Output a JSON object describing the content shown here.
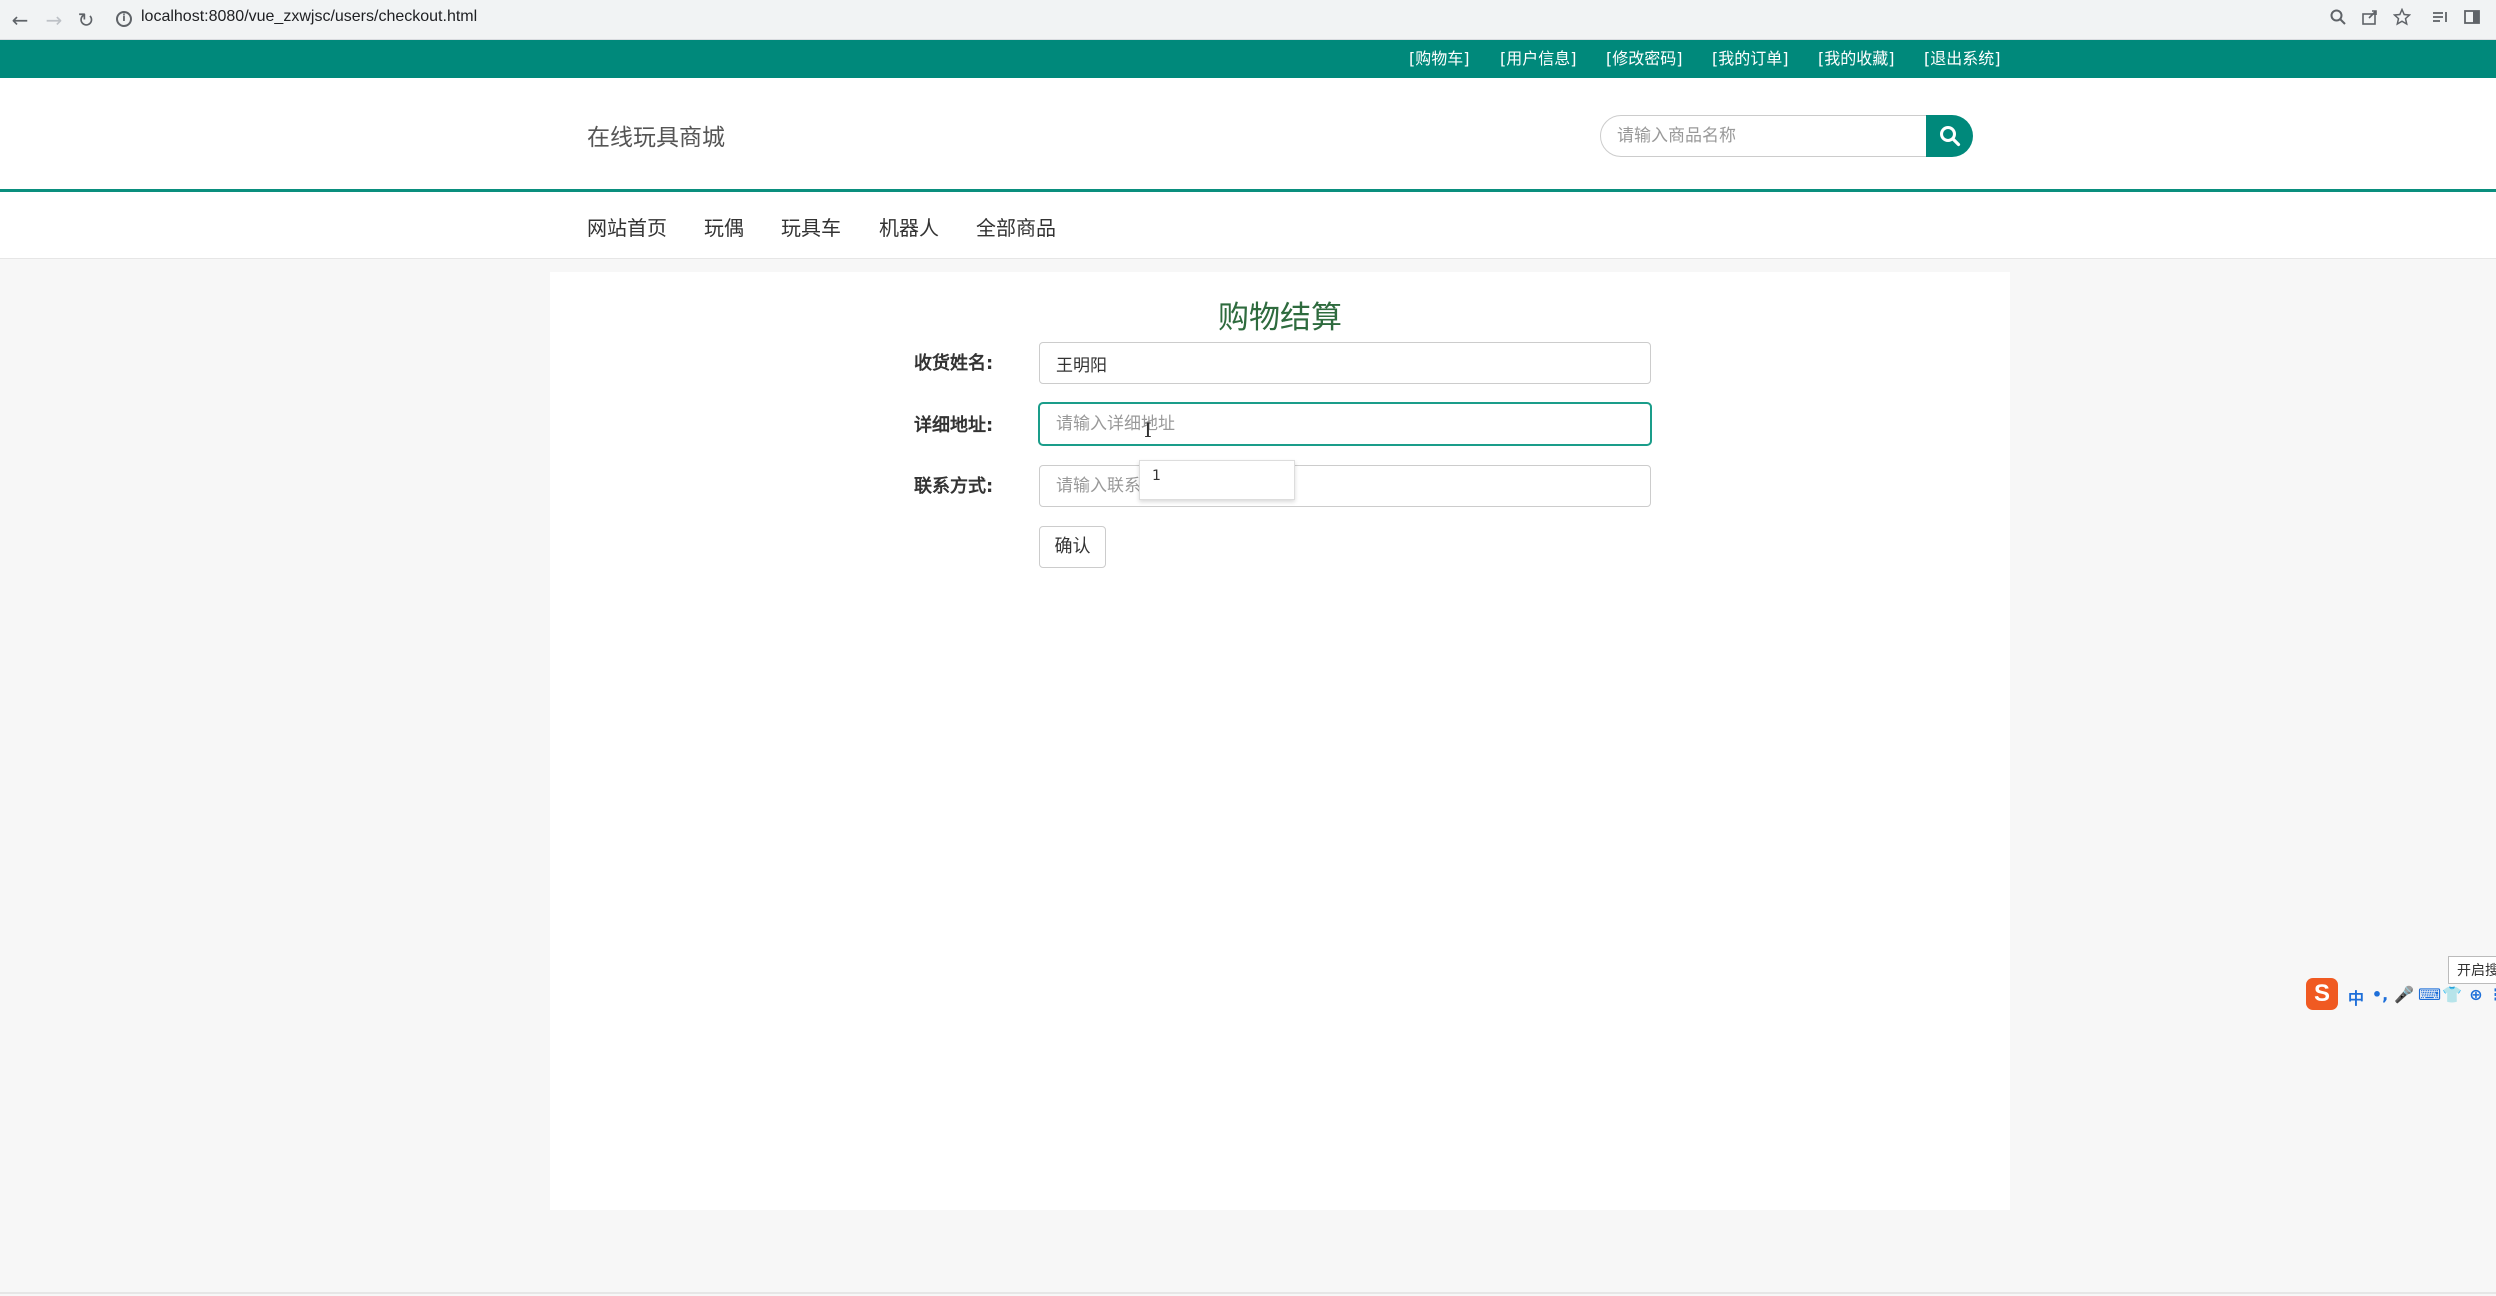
{
  "browser": {
    "url": "localhost:8080/vue_zxwjsc/users/checkout.html",
    "back": "←",
    "forward": "→",
    "reload": "↻",
    "info": "i"
  },
  "top_links": [
    "[购物车]",
    "[用户信息]",
    "[修改密码]",
    "[我的订单]",
    "[我的收藏]",
    "[退出系统]"
  ],
  "header": {
    "site_name": "在线玩具商城",
    "search_placeholder": "请输入商品名称"
  },
  "nav": [
    "网站首页",
    "玩偶",
    "玩具车",
    "机器人",
    "全部商品"
  ],
  "checkout": {
    "title": "购物结算",
    "name_label": "收货姓名:",
    "name_value": "王明阳",
    "address_label": "详细地址:",
    "address_placeholder": "请输入详细地址",
    "phone_label": "联系方式:",
    "phone_placeholder": "请输入联系方式",
    "autocomplete_item": "1",
    "confirm": "确认"
  },
  "ime": {
    "logo": "S",
    "icons": [
      "中",
      "•,",
      "🎤",
      "⌨",
      "👕",
      "⊕",
      "⋮"
    ],
    "tooltip": "开启搜狗"
  },
  "colors": {
    "primary": "#00897b",
    "title_green": "#2e6b3e"
  }
}
